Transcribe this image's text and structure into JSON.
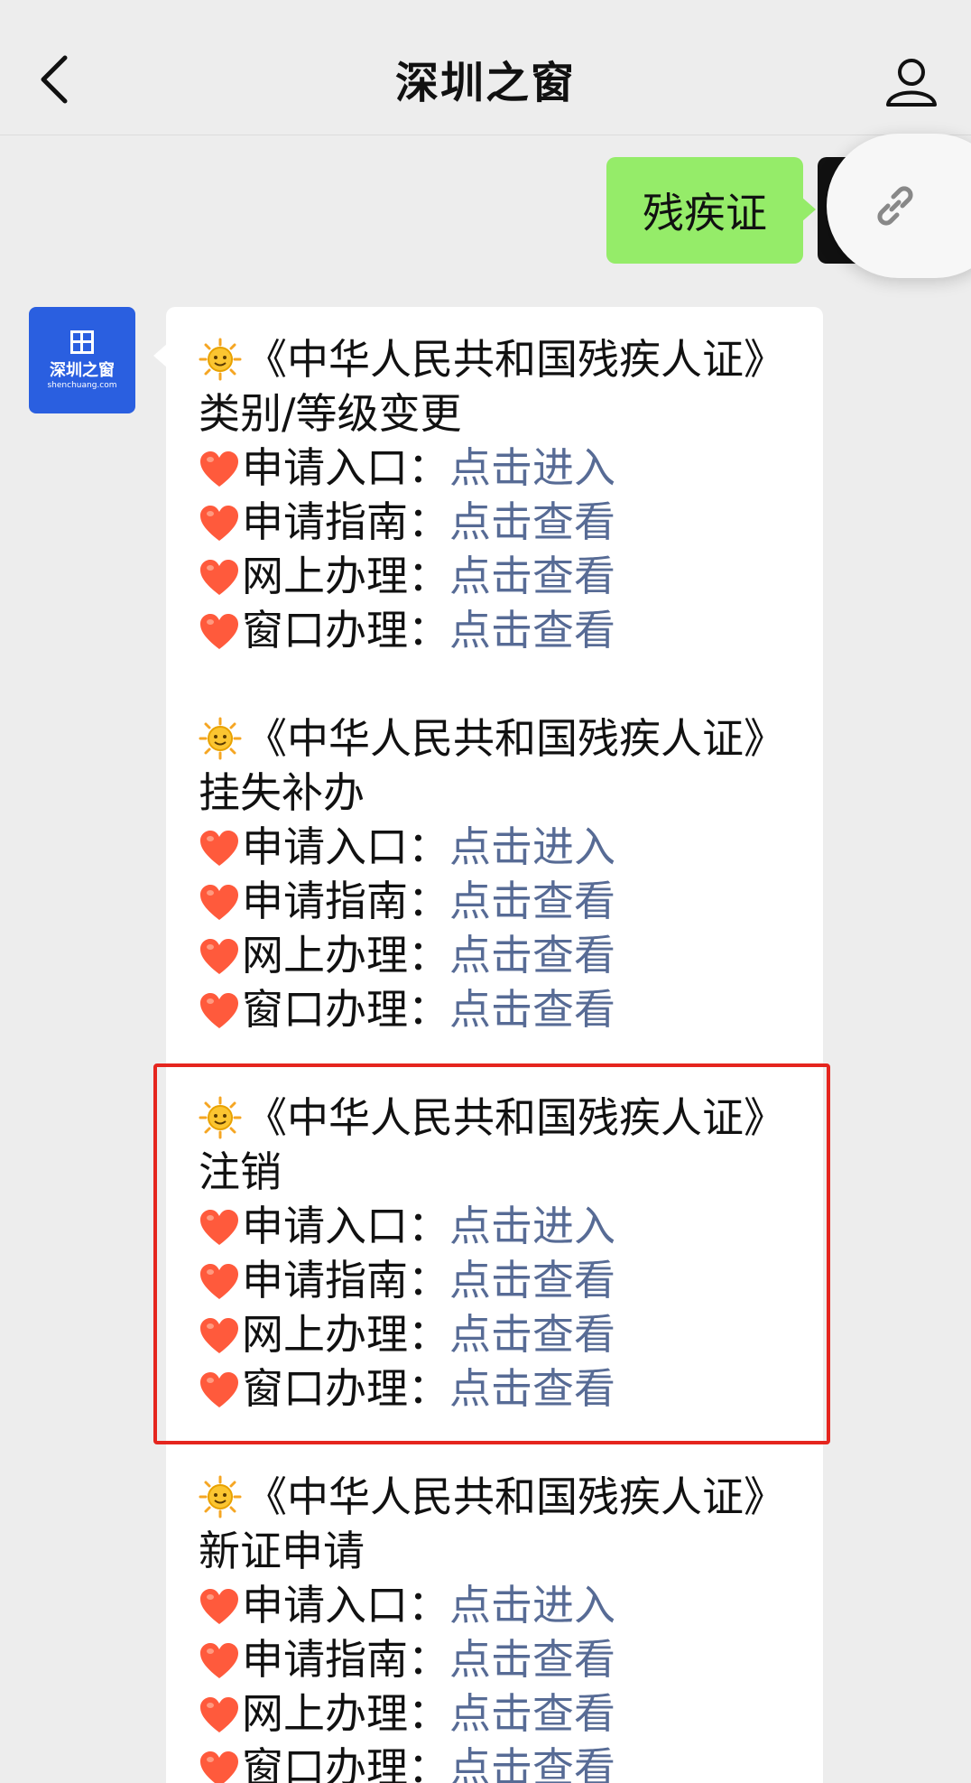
{
  "header": {
    "title": "深圳之窗"
  },
  "outgoing_message": {
    "text": "残疾证"
  },
  "incoming_avatar": {
    "logo_text": "深圳之窗",
    "logo_sub": "shenchuang.com"
  },
  "sections": [
    {
      "title": "《中华人民共和国残疾人证》类别/等级变更",
      "rows": [
        {
          "label": "申请入口：",
          "link": "点击进入"
        },
        {
          "label": "申请指南：",
          "link": "点击查看"
        },
        {
          "label": "网上办理：",
          "link": "点击查看"
        },
        {
          "label": "窗口办理：",
          "link": "点击查看"
        }
      ]
    },
    {
      "title": "《中华人民共和国残疾人证》挂失补办",
      "rows": [
        {
          "label": "申请入口：",
          "link": "点击进入"
        },
        {
          "label": "申请指南：",
          "link": "点击查看"
        },
        {
          "label": "网上办理：",
          "link": "点击查看"
        },
        {
          "label": "窗口办理：",
          "link": "点击查看"
        }
      ]
    },
    {
      "title": "《中华人民共和国残疾人证》注销",
      "rows": [
        {
          "label": "申请入口：",
          "link": "点击进入"
        },
        {
          "label": "申请指南：",
          "link": "点击查看"
        },
        {
          "label": "网上办理：",
          "link": "点击查看"
        },
        {
          "label": "窗口办理：",
          "link": "点击查看"
        }
      ]
    },
    {
      "title": "《中华人民共和国残疾人证》新证申请",
      "rows": [
        {
          "label": "申请入口：",
          "link": "点击进入"
        },
        {
          "label": "申请指南：",
          "link": "点击查看"
        },
        {
          "label": "网上办理：",
          "link": "点击查看"
        },
        {
          "label": "窗口办理：",
          "link": "点击查看"
        }
      ]
    }
  ],
  "colors": {
    "link": "#576b95",
    "highlight": "#e5251e",
    "outgoing_bubble": "#95ec69",
    "avatar_brand": "#2a5fe0"
  },
  "icons": {
    "section_emoji": "sun-icon",
    "row_emoji": "heart-icon"
  }
}
